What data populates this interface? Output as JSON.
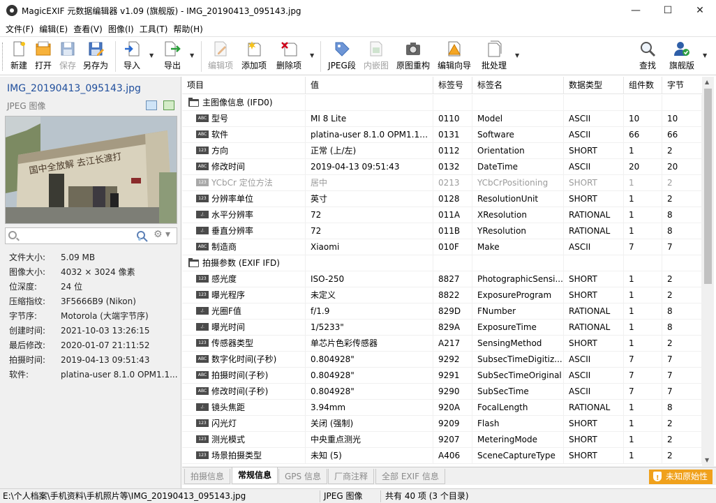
{
  "window": {
    "title": "MagicEXIF 元数据编辑器 v1.09 (旗舰版) - IMG_20190413_095143.jpg",
    "minimize": "—",
    "maximize": "☐",
    "close": "✕"
  },
  "menu": [
    "文件(F)",
    "编辑(E)",
    "查看(V)",
    "图像(I)",
    "工具(T)",
    "帮助(H)"
  ],
  "toolbar": {
    "new": "新建",
    "open": "打开",
    "save": "保存",
    "save_as": "另存为",
    "import": "导入",
    "export": "导出",
    "edit_item": "编辑项",
    "add_item": "添加项",
    "delete_item": "删除项",
    "jpeg_segment": "JPEG段",
    "embedded_thumb": "内嵌图",
    "rebuild": "原图重构",
    "edit_wizard": "编辑向导",
    "batch": "批处理",
    "find": "查找",
    "edition": "旗舰版"
  },
  "left": {
    "file_name": "IMG_20190413_095143.jpg",
    "file_type": "JPEG 图像",
    "search_placeholder": "",
    "photo_sign": "国中全放解 去江长渡打",
    "info": [
      {
        "k": "文件大小:",
        "v": "5.09 MB"
      },
      {
        "k": "图像大小:",
        "v": "4032 × 3024 像素"
      },
      {
        "k": "位深度:",
        "v": "24 位"
      },
      {
        "k": "压缩指纹:",
        "v": "3F5666B9 (Nikon)"
      },
      {
        "k": "字节序:",
        "v": "Motorola (大端字节序)"
      },
      {
        "k": "创建时间:",
        "v": "2021-10-03 13:26:15"
      },
      {
        "k": "最后修改:",
        "v": "2020-01-07 21:11:52"
      },
      {
        "k": "拍摄时间:",
        "v": "2019-04-13 09:51:43"
      },
      {
        "k": "软件:",
        "v": "platina-user 8.1.0 OPM1.1..."
      }
    ]
  },
  "table": {
    "headers": [
      "项目",
      "值",
      "标签号",
      "标签名",
      "数据类型",
      "组件数",
      "字节"
    ],
    "rows": [
      {
        "group": true,
        "item": "主图像信息 (IFD0)"
      },
      {
        "icon": "ABC",
        "item": "型号",
        "value": "MI 8 Lite",
        "tag": "0110",
        "name": "Model",
        "type": "ASCII",
        "count": "10",
        "bytes": "10"
      },
      {
        "icon": "ABC",
        "item": "软件",
        "value": "platina-user 8.1.0 OPM1.17...",
        "tag": "0131",
        "name": "Software",
        "type": "ASCII",
        "count": "66",
        "bytes": "66"
      },
      {
        "icon": "123",
        "item": "方向",
        "value": "正常 (上/左)",
        "tag": "0112",
        "name": "Orientation",
        "type": "SHORT",
        "count": "1",
        "bytes": "2"
      },
      {
        "icon": "ABC",
        "item": "修改时间",
        "value": "2019-04-13 09:51:43",
        "tag": "0132",
        "name": "DateTime",
        "type": "ASCII",
        "count": "20",
        "bytes": "20"
      },
      {
        "icon": "123",
        "item": "YCbCr 定位方法",
        "value": "居中",
        "tag": "0213",
        "name": "YCbCrPositioning",
        "type": "SHORT",
        "count": "1",
        "bytes": "2",
        "dim": true
      },
      {
        "icon": "123",
        "item": "分辨率单位",
        "value": "英寸",
        "tag": "0128",
        "name": "ResolutionUnit",
        "type": "SHORT",
        "count": "1",
        "bytes": "2"
      },
      {
        "icon": "./.",
        "item": "水平分辨率",
        "value": "72",
        "tag": "011A",
        "name": "XResolution",
        "type": "RATIONAL",
        "count": "1",
        "bytes": "8"
      },
      {
        "icon": "./.",
        "item": "垂直分辨率",
        "value": "72",
        "tag": "011B",
        "name": "YResolution",
        "type": "RATIONAL",
        "count": "1",
        "bytes": "8"
      },
      {
        "icon": "ABC",
        "item": "制造商",
        "value": "Xiaomi",
        "tag": "010F",
        "name": "Make",
        "type": "ASCII",
        "count": "7",
        "bytes": "7"
      },
      {
        "group": true,
        "item": "拍摄参数 (EXIF IFD)"
      },
      {
        "icon": "123",
        "item": "感光度",
        "value": "ISO-250",
        "tag": "8827",
        "name": "PhotographicSensi...",
        "type": "SHORT",
        "count": "1",
        "bytes": "2"
      },
      {
        "icon": "123",
        "item": "曝光程序",
        "value": "未定义",
        "tag": "8822",
        "name": "ExposureProgram",
        "type": "SHORT",
        "count": "1",
        "bytes": "2"
      },
      {
        "icon": "./.",
        "item": "光圈F值",
        "value": "f/1.9",
        "tag": "829D",
        "name": "FNumber",
        "type": "RATIONAL",
        "count": "1",
        "bytes": "8"
      },
      {
        "icon": "./.",
        "item": "曝光时间",
        "value": "1/5233\"",
        "tag": "829A",
        "name": "ExposureTime",
        "type": "RATIONAL",
        "count": "1",
        "bytes": "8"
      },
      {
        "icon": "123",
        "item": "传感器类型",
        "value": "单芯片色彩传感器",
        "tag": "A217",
        "name": "SensingMethod",
        "type": "SHORT",
        "count": "1",
        "bytes": "2"
      },
      {
        "icon": "ABC",
        "item": "数字化时间(子秒)",
        "value": "0.804928\"",
        "tag": "9292",
        "name": "SubsecTimeDigitiz...",
        "type": "ASCII",
        "count": "7",
        "bytes": "7"
      },
      {
        "icon": "ABC",
        "item": "拍摄时间(子秒)",
        "value": "0.804928\"",
        "tag": "9291",
        "name": "SubSecTimeOriginal",
        "type": "ASCII",
        "count": "7",
        "bytes": "7"
      },
      {
        "icon": "ABC",
        "item": "修改时间(子秒)",
        "value": "0.804928\"",
        "tag": "9290",
        "name": "SubSecTime",
        "type": "ASCII",
        "count": "7",
        "bytes": "7"
      },
      {
        "icon": "./.",
        "item": "镜头焦距",
        "value": "3.94mm",
        "tag": "920A",
        "name": "FocalLength",
        "type": "RATIONAL",
        "count": "1",
        "bytes": "8"
      },
      {
        "icon": "123",
        "item": "闪光灯",
        "value": "关闭 (强制)",
        "tag": "9209",
        "name": "Flash",
        "type": "SHORT",
        "count": "1",
        "bytes": "2"
      },
      {
        "icon": "123",
        "item": "测光模式",
        "value": "中央重点测光",
        "tag": "9207",
        "name": "MeteringMode",
        "type": "SHORT",
        "count": "1",
        "bytes": "2"
      },
      {
        "icon": "123",
        "item": "场景拍摄类型",
        "value": "未知 (5)",
        "tag": "A406",
        "name": "SceneCaptureType",
        "type": "SHORT",
        "count": "1",
        "bytes": "2"
      }
    ]
  },
  "tabs": [
    "拍摄信息",
    "常规信息",
    "GPS 信息",
    "厂商注释",
    "全部 EXIF 信息"
  ],
  "active_tab": 1,
  "badge": "未知原始性",
  "status": {
    "path": "E:\\个人档案\\手机资料\\手机照片等\\IMG_20190413_095143.jpg",
    "type": "JPEG 图像",
    "count": "共有 40 项 (3 个目录)"
  }
}
